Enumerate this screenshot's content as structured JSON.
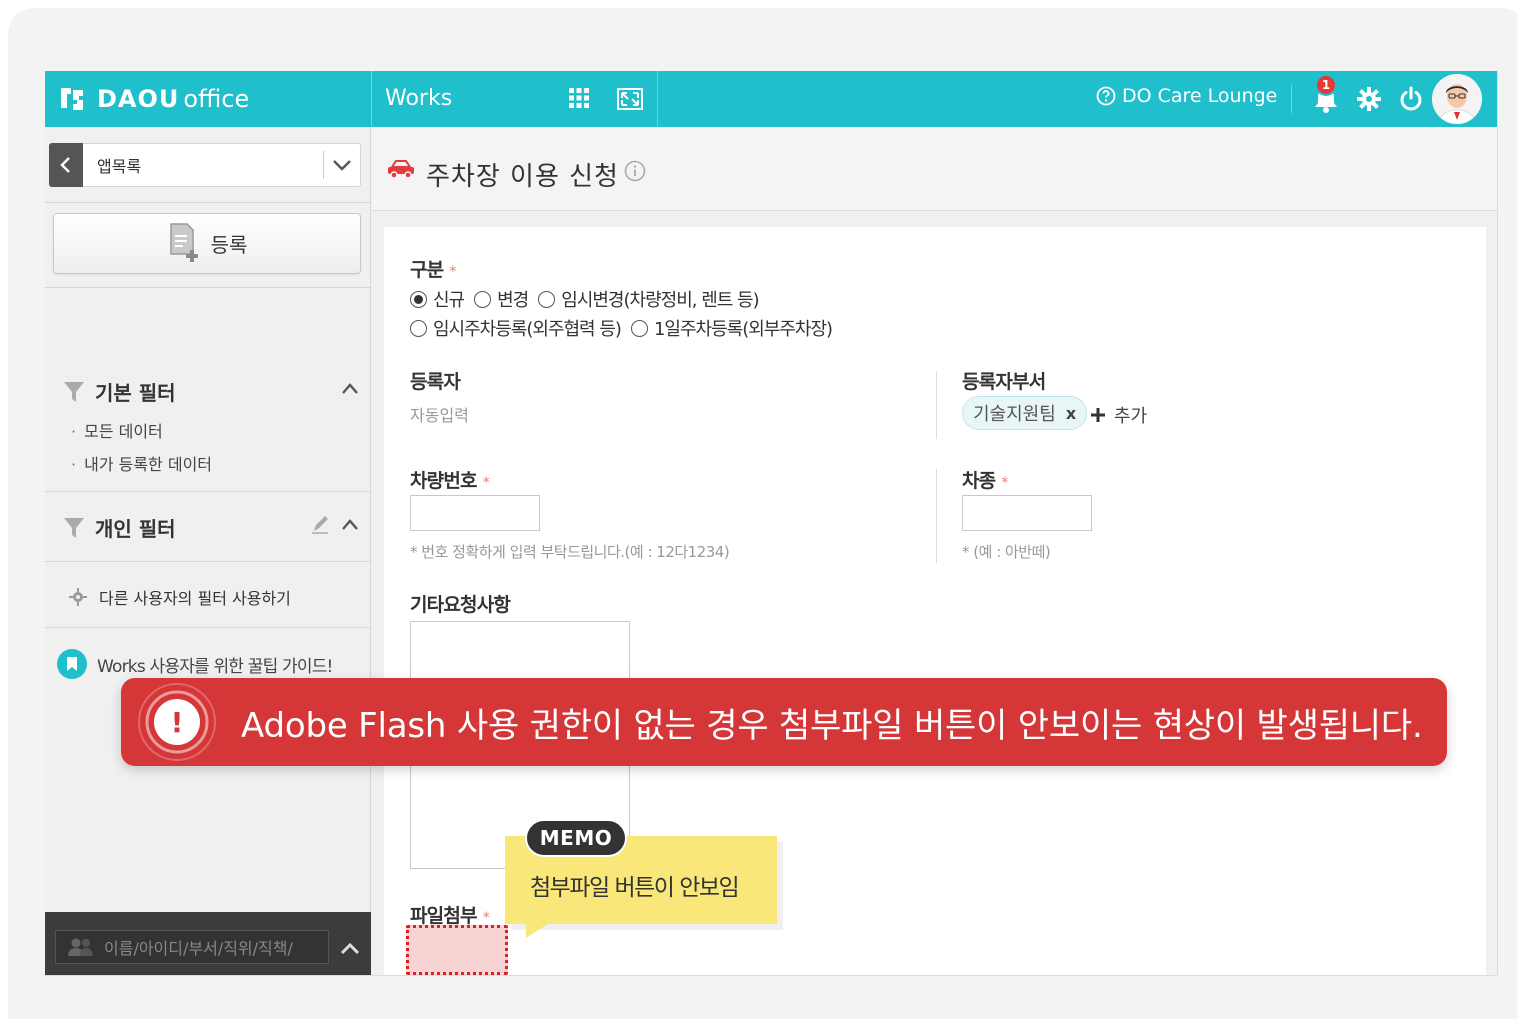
{
  "header": {
    "brand": "DAOU",
    "brand_sub": "office",
    "app_title": "Works",
    "care_link": "DO Care Lounge",
    "notification_count": "1",
    "accent_color": "#1fbfcc"
  },
  "sidebar": {
    "app_select_label": "앱목록",
    "register_label": "등록",
    "basic_filter": {
      "title": "기본 필터",
      "items": [
        "모든 데이터",
        "내가 등록한 데이터"
      ]
    },
    "personal_filter": {
      "title": "개인 필터"
    },
    "other_user_filter": "다른 사용자의 필터 사용하기",
    "guide_link": "Works 사용자를 위한 꿀팁 가이드!",
    "search_placeholder": "이름/아이디/부서/직위/직책/"
  },
  "page": {
    "title": "주차장 이용 신청"
  },
  "form": {
    "category": {
      "label": "구분",
      "required_mark": "*",
      "options": [
        {
          "label": "신규",
          "selected": true
        },
        {
          "label": "변경",
          "selected": false
        },
        {
          "label": "임시변경(차량정비, 렌트 등)",
          "selected": false
        },
        {
          "label": "임시주차등록(외주협력 등)",
          "selected": false
        },
        {
          "label": "1일주차등록(외부주차장)",
          "selected": false
        }
      ]
    },
    "registrant": {
      "label": "등록자",
      "value": "자동입력"
    },
    "registrant_dept": {
      "label": "등록자부서",
      "tag": "기술지원팀",
      "remove": "x",
      "add_label": "추가"
    },
    "car_number": {
      "label": "차량번호",
      "required_mark": "*",
      "value": "",
      "hint": "* 번호 정확하게 입력 부탁드립니다.(예 : 12다1234)"
    },
    "car_type": {
      "label": "차종",
      "required_mark": "*",
      "value": "",
      "hint": "* (예 : 아반떼)"
    },
    "other_request": {
      "label": "기타요청사항",
      "value": ""
    },
    "attachment": {
      "label": "파일첨부",
      "required_mark": "*"
    }
  },
  "overlay": {
    "alert_text": "Adobe Flash 사용 권한이 없는 경우 첨부파일 버튼이 안보이는 현상이 발생됩니다.",
    "alert_icon_symbol": "!",
    "alert_color": "#d53637",
    "memo_badge": "MEMO",
    "memo_text": "첨부파일 버튼이 안보임",
    "memo_color": "#f9e77a"
  }
}
